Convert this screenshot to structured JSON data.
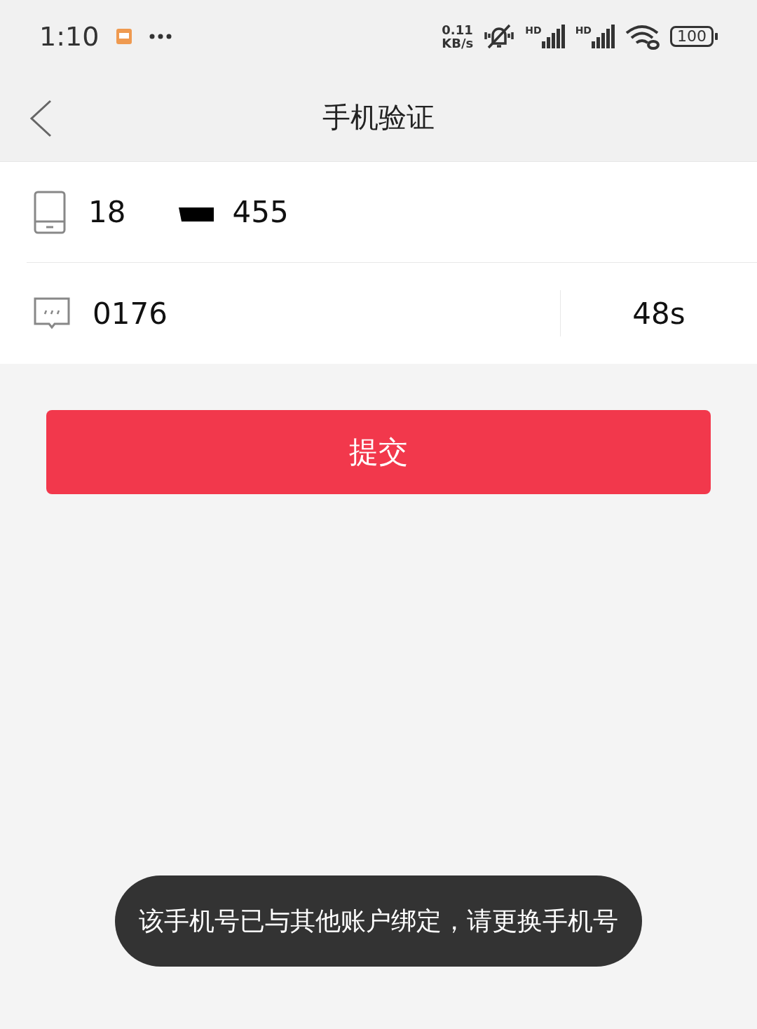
{
  "status_bar": {
    "time": "1:10",
    "net_speed": "0.11",
    "net_unit": "KB/s",
    "signals": [
      {
        "label": "HD"
      },
      {
        "label": "HD"
      }
    ],
    "battery": "100"
  },
  "nav": {
    "title": "手机验证"
  },
  "form": {
    "phone": {
      "value_start": "18",
      "value_end": "455"
    },
    "code": {
      "value": "0176",
      "countdown": "48s"
    }
  },
  "submit": {
    "label": "提交"
  },
  "toast": {
    "text": "该手机号已与其他账户绑定，请更换手机号"
  }
}
